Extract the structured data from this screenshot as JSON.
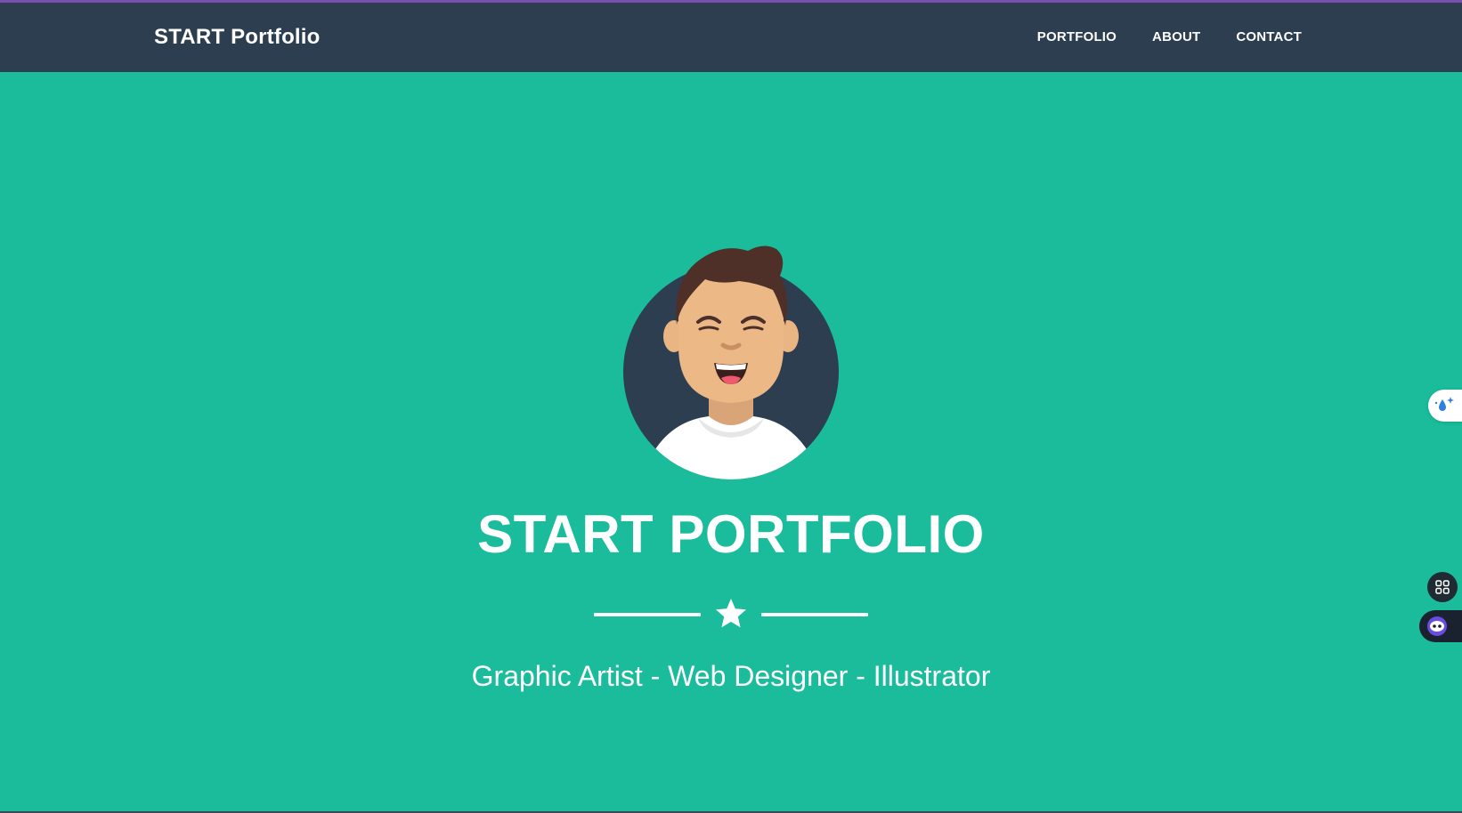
{
  "navbar": {
    "brand": "START Portfolio",
    "links": [
      {
        "label": "PORTFOLIO"
      },
      {
        "label": "ABOUT"
      },
      {
        "label": "CONTACT"
      }
    ]
  },
  "hero": {
    "heading": "START PORTFOLIO",
    "subheading": "Graphic Artist - Web Designer - Illustrator",
    "divider_icon": "star-icon",
    "avatar_icon": "avatar-illustration"
  },
  "side_widgets": {
    "top_icon": "sparkle-drop-icon",
    "apps_icon": "grid-apps-icon",
    "assistant_icon": "bot-face-icon"
  },
  "colors": {
    "hero_bg": "#1abc9c",
    "navbar_bg": "#2c3e50",
    "text": "#ffffff",
    "accent_strip": "#7b4fb0"
  }
}
